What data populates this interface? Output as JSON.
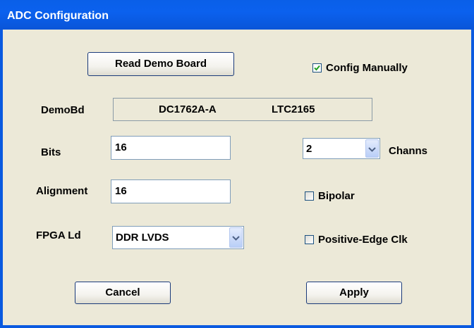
{
  "window": {
    "title": "ADC Configuration"
  },
  "buttons": {
    "read_demo_board": "Read Demo Board",
    "cancel": "Cancel",
    "apply": "Apply"
  },
  "config_manually": {
    "label": "Config Manually",
    "checked": true
  },
  "demo_board": {
    "label": "DemoBd",
    "board": "DC1762A-A",
    "part": "LTC2165"
  },
  "bits": {
    "label": "Bits",
    "value": "16"
  },
  "alignment": {
    "label": "Alignment",
    "value": "16"
  },
  "fpga_load": {
    "label": "FPGA Ld",
    "value": "DDR LVDS"
  },
  "channels": {
    "label": "Channs",
    "value": "2"
  },
  "bipolar": {
    "label": "Bipolar",
    "checked": false
  },
  "positive_edge_clk": {
    "label": "Positive-Edge Clk",
    "checked": false
  },
  "icons": {
    "dropdown": "chevron-down-icon",
    "check": "checkmark-icon"
  },
  "colors": {
    "titlebar": "#0a5fe8",
    "dialog_bg": "#ece9d8",
    "button_border": "#1a3a7a",
    "check": "#21a121"
  }
}
